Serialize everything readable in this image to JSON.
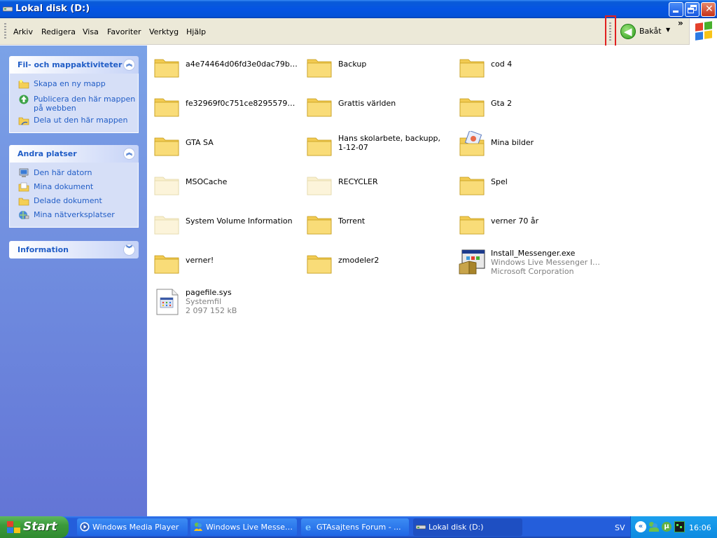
{
  "window": {
    "title": "Lokal disk (D:)"
  },
  "menu": [
    "Arkiv",
    "Redigera",
    "Visa",
    "Favoriter",
    "Verktyg",
    "Hjälp"
  ],
  "toolbar": {
    "back_label": "Bakåt",
    "chevron": "»"
  },
  "taskpane": {
    "file_tasks": {
      "title": "Fil- och mappaktiviteter",
      "links": [
        "Skapa en ny mapp",
        "Publicera den här mappen på webben",
        "Dela ut den här mappen"
      ]
    },
    "other_places": {
      "title": "Andra platser",
      "links": [
        "Den här datorn",
        "Mina dokument",
        "Delade dokument",
        "Mina nätverksplatser"
      ]
    },
    "details": {
      "title": "Information"
    }
  },
  "items": [
    {
      "name": "a4e74464d06fd3e0dac79b41c4",
      "type": "folder"
    },
    {
      "name": "Backup",
      "type": "folder"
    },
    {
      "name": "cod 4",
      "type": "folder"
    },
    {
      "name": "fe32969f0c751ce8295579dd7...",
      "type": "folder"
    },
    {
      "name": "Grattis världen",
      "type": "folder"
    },
    {
      "name": "Gta 2",
      "type": "folder"
    },
    {
      "name": "GTA SA",
      "type": "folder"
    },
    {
      "name": "Hans skolarbete, backupp, 1-12-07",
      "type": "folder"
    },
    {
      "name": "Mina bilder",
      "type": "pictures"
    },
    {
      "name": "MSOCache",
      "type": "hidden-folder"
    },
    {
      "name": "RECYCLER",
      "type": "hidden-folder"
    },
    {
      "name": "Spel",
      "type": "folder"
    },
    {
      "name": "System Volume Information",
      "type": "hidden-folder"
    },
    {
      "name": "Torrent",
      "type": "folder"
    },
    {
      "name": "verner 70 år",
      "type": "folder"
    },
    {
      "name": "verner!",
      "type": "folder"
    },
    {
      "name": "zmodeler2",
      "type": "folder"
    },
    {
      "name": "Install_Messenger.exe",
      "type": "installer",
      "sub1": "Windows Live Messenger Inst...",
      "sub2": "Microsoft Corporation"
    },
    {
      "name": "pagefile.sys",
      "type": "sysfile",
      "sub1": "Systemfil",
      "sub2": "2 097 152 kB"
    }
  ],
  "taskbar": {
    "start_label": "Start",
    "tasks": [
      "Windows Media Player",
      "Windows Live Messen...",
      "GTAsajtens Forum - ...",
      "Lokal disk (D:)"
    ],
    "language": "SV",
    "clock": "16:06"
  },
  "colors": {
    "titlebar": "#0554e3",
    "taskpane": "#6f8fe0",
    "link": "#215dc6",
    "annotation": "#e02020"
  }
}
